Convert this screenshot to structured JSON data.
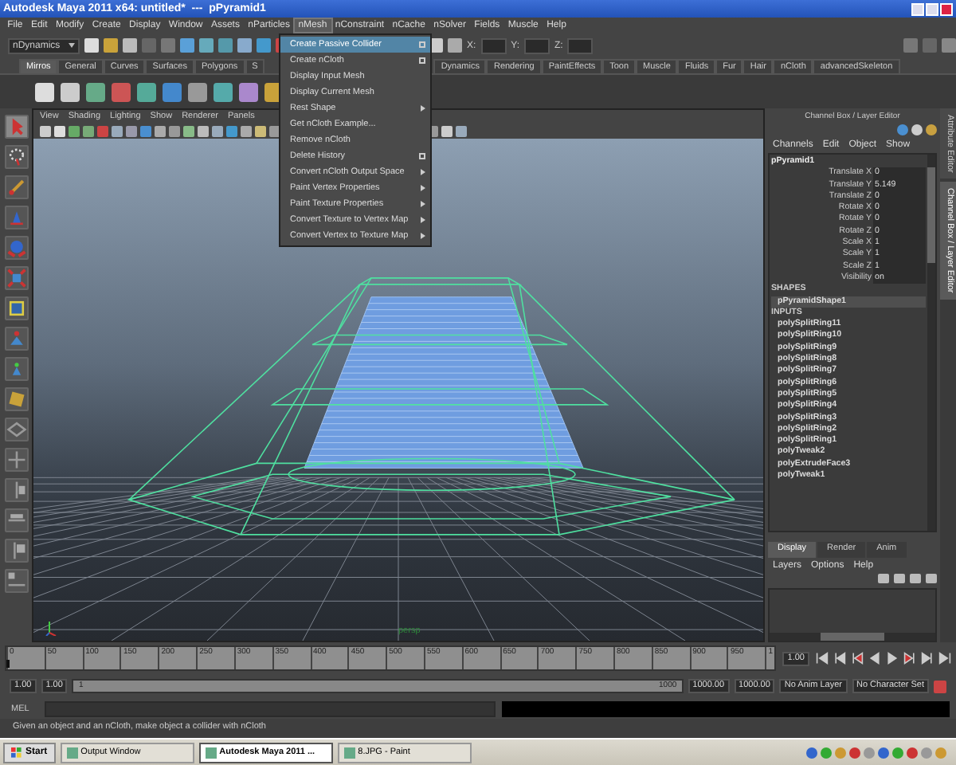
{
  "window": {
    "title": "Autodesk Maya 2011 x64: untitled*  ---  pPyramid1"
  },
  "menu_bar": [
    {
      "label": "File",
      "selected": false
    },
    {
      "label": "Edit",
      "selected": false
    },
    {
      "label": "Modify",
      "selected": false
    },
    {
      "label": "Create",
      "selected": false
    },
    {
      "label": "Display",
      "selected": false
    },
    {
      "label": "Window",
      "selected": false
    },
    {
      "label": "Assets",
      "selected": false
    },
    {
      "label": "nParticles",
      "selected": false
    },
    {
      "label": "nMesh",
      "selected": true
    },
    {
      "label": "nConstraint",
      "selected": false
    },
    {
      "label": "nCache",
      "selected": false
    },
    {
      "label": "nSolver",
      "selected": false
    },
    {
      "label": "Fields",
      "selected": false
    },
    {
      "label": "Muscle",
      "selected": false
    },
    {
      "label": "Help",
      "selected": false
    }
  ],
  "toolbar": {
    "menu_set": "nDynamics",
    "x_label": "X:",
    "y_label": "Y:",
    "z_label": "Z:"
  },
  "shelf_tabs_left": [
    {
      "label": "Mirros",
      "selected": true
    },
    {
      "label": "General",
      "selected": false
    },
    {
      "label": "Curves",
      "selected": false
    },
    {
      "label": "Surfaces",
      "selected": false
    },
    {
      "label": "Polygons",
      "selected": false
    },
    {
      "label": "S",
      "selected": false
    }
  ],
  "shelf_tabs_right": [
    {
      "label": "Dynamics",
      "selected": false
    },
    {
      "label": "Rendering",
      "selected": false
    },
    {
      "label": "PaintEffects",
      "selected": false
    },
    {
      "label": "Toon",
      "selected": false
    },
    {
      "label": "Muscle",
      "selected": false
    },
    {
      "label": "Fluids",
      "selected": false
    },
    {
      "label": "Fur",
      "selected": false
    },
    {
      "label": "Hair",
      "selected": false
    },
    {
      "label": "nCloth",
      "selected": false
    },
    {
      "label": "advancedSkeleton",
      "selected": false
    }
  ],
  "open_menu": {
    "items": [
      {
        "label": "Create Passive Collider",
        "kind": "option",
        "selected": true
      },
      {
        "label": "Create nCloth",
        "kind": "option",
        "selected": false
      },
      {
        "label": "Display Input Mesh",
        "kind": "plain",
        "selected": false
      },
      {
        "label": "Display Current Mesh",
        "kind": "plain",
        "selected": false
      },
      {
        "label": "Rest Shape",
        "kind": "submenu",
        "selected": false
      },
      {
        "label": "Get nCloth Example...",
        "kind": "plain",
        "selected": false
      },
      {
        "label": "Remove nCloth",
        "kind": "plain",
        "selected": false
      },
      {
        "label": "Delete History",
        "kind": "option",
        "selected": false
      },
      {
        "label": "Convert nCloth Output Space",
        "kind": "submenu",
        "selected": false
      },
      {
        "label": "Paint Vertex Properties",
        "kind": "submenu",
        "selected": false
      },
      {
        "label": "Paint Texture Properties",
        "kind": "submenu",
        "selected": false
      },
      {
        "label": "Convert Texture to Vertex Map",
        "kind": "submenu",
        "selected": false
      },
      {
        "label": "Convert Vertex to Texture Map",
        "kind": "submenu",
        "selected": false
      }
    ]
  },
  "viewport": {
    "menus": [
      "View",
      "Shading",
      "Lighting",
      "Show",
      "Renderer",
      "Panels"
    ],
    "camera_label": "persp"
  },
  "channel_box": {
    "title": "Channel Box / Layer Editor",
    "menus": [
      "Channels",
      "Edit",
      "Object",
      "Show"
    ],
    "object": "pPyramid1",
    "attributes": [
      {
        "name": "Translate X",
        "value": "0"
      },
      {
        "name": "Translate Y",
        "value": "5.149"
      },
      {
        "name": "Translate Z",
        "value": "0"
      },
      {
        "name": "Rotate X",
        "value": "0"
      },
      {
        "name": "Rotate Y",
        "value": "0"
      },
      {
        "name": "Rotate Z",
        "value": "0"
      },
      {
        "name": "Scale X",
        "value": "1"
      },
      {
        "name": "Scale Y",
        "value": "1"
      },
      {
        "name": "Scale Z",
        "value": "1"
      },
      {
        "name": "Visibility",
        "value": "on"
      }
    ],
    "shapes_heading": "SHAPES",
    "shapes": [
      {
        "label": "pPyramidShape1",
        "selected": true
      }
    ],
    "inputs_heading": "INPUTS",
    "inputs": [
      "polySplitRing11",
      "polySplitRing10",
      "polySplitRing9",
      "polySplitRing8",
      "polySplitRing7",
      "polySplitRing6",
      "polySplitRing5",
      "polySplitRing4",
      "polySplitRing3",
      "polySplitRing2",
      "polySplitRing1",
      "polyTweak2",
      "polyExtrudeFace3",
      "polyTweak1"
    ]
  },
  "side_tabs": [
    {
      "label": "Attribute Editor",
      "selected": false
    },
    {
      "label": "Channel Box / Layer Editor",
      "selected": true
    }
  ],
  "layer_editor": {
    "tabs": [
      {
        "label": "Display",
        "selected": true
      },
      {
        "label": "Render",
        "selected": false
      },
      {
        "label": "Anim",
        "selected": false
      }
    ],
    "menus": [
      "Layers",
      "Options",
      "Help"
    ]
  },
  "time_slider": {
    "ticks": [
      "0",
      "50",
      "100",
      "150",
      "200",
      "250",
      "300",
      "350",
      "400",
      "450",
      "500",
      "550",
      "600",
      "650",
      "700",
      "750",
      "800",
      "850",
      "900",
      "950",
      "1"
    ],
    "current_frame": "1.00",
    "level": 0
  },
  "range_slider": {
    "start": "1.00",
    "playback_start": "1.00",
    "range_start": "1",
    "range_end": "1000",
    "level": 1,
    "playback_end": "1000.00",
    "end": "1000.00",
    "anim_layer": "No Anim Layer",
    "character_set": "No Character Set"
  },
  "command_line": {
    "label": "MEL"
  },
  "help_line": "Given an object and an nCloth, make object a collider with nCloth",
  "taskbar": {
    "start": "Start",
    "tasks": [
      {
        "label": "Output Window",
        "selected": false
      },
      {
        "label": "Autodesk Maya 2011 ...",
        "selected": true
      },
      {
        "label": "8.JPG - Paint",
        "selected": false
      }
    ]
  }
}
